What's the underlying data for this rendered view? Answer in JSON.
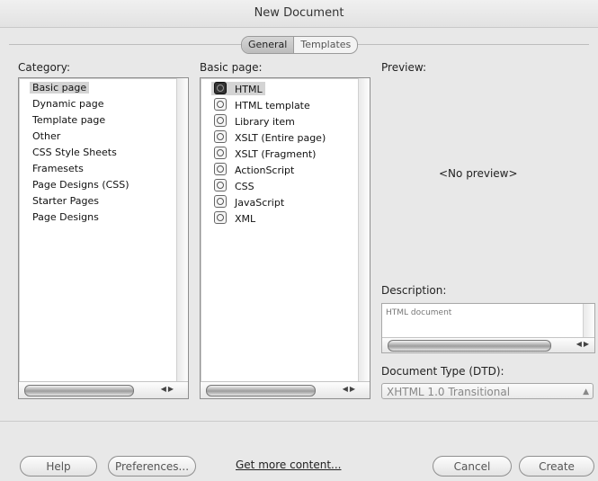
{
  "window": {
    "title": "New Document"
  },
  "tabs": [
    {
      "label": "General",
      "active": true
    },
    {
      "label": "Templates",
      "active": false
    }
  ],
  "category": {
    "label": "Category:",
    "items": [
      "Basic page",
      "Dynamic page",
      "Template page",
      "Other",
      "CSS Style Sheets",
      "Framesets",
      "Page Designs (CSS)",
      "Starter Pages",
      "Page Designs"
    ],
    "selected": "Basic page"
  },
  "basic_page": {
    "label": "Basic page:",
    "items": [
      "HTML",
      "HTML template",
      "Library item",
      "XSLT (Entire page)",
      "XSLT (Fragment)",
      "ActionScript",
      "CSS",
      "JavaScript",
      "XML"
    ],
    "selected": "HTML",
    "icon": "file-icon"
  },
  "preview": {
    "label": "Preview:",
    "empty_text": "<No preview>"
  },
  "description": {
    "label": "Description:",
    "text": "HTML document"
  },
  "doctype": {
    "label": "Document Type (DTD):",
    "value": "XHTML 1.0 Transitional"
  },
  "footer": {
    "help": "Help",
    "preferences": "Preferences...",
    "more": "Get more content...",
    "cancel": "Cancel",
    "create": "Create"
  },
  "colors": {
    "window_bg": "#e8e8e8",
    "selection": "#d4d4d4"
  }
}
